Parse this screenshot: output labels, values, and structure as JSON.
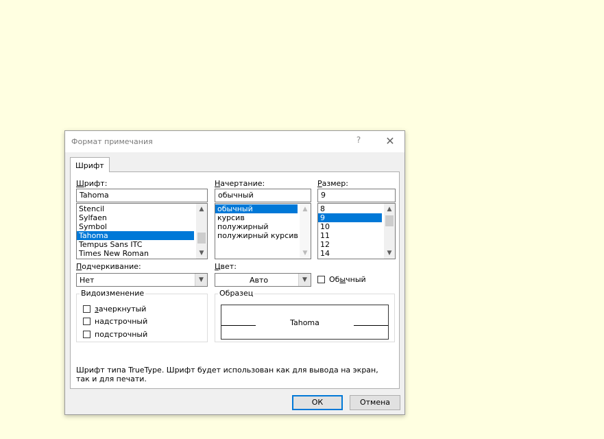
{
  "dialog": {
    "title": "Формат примечания",
    "help_label": "?",
    "close_label": "✕"
  },
  "tabs": [
    {
      "label": "Шрифт",
      "active": true
    }
  ],
  "font": {
    "label_prefix": "Ш",
    "label_rest": "рифт:",
    "value": "Tahoma",
    "items": [
      "Stencil",
      "Sylfaen",
      "Symbol",
      "Tahoma",
      "Tempus Sans ITC",
      "Times New Roman"
    ],
    "selected_index": 3
  },
  "style": {
    "label_prefix": "Н",
    "label_rest": "ачертание:",
    "value": "обычный",
    "items": [
      "обычный",
      "курсив",
      "полужирный",
      "полужирный курсив"
    ],
    "selected_index": 0
  },
  "size": {
    "label_prefix": "Р",
    "label_rest": "азмер:",
    "value": "9",
    "items": [
      "8",
      "9",
      "10",
      "11",
      "12",
      "14"
    ],
    "selected_index": 1
  },
  "underline": {
    "label_prefix": "П",
    "label_rest": "одчеркивание:",
    "value": "Нет"
  },
  "color": {
    "label_prefix": "Ц",
    "label_rest": "вет:",
    "value": "Авто"
  },
  "normal_checkbox": {
    "label_start": "Об",
    "label_underlined": "ы",
    "label_end": "чный",
    "checked": false
  },
  "effects": {
    "title": "Видоизменение",
    "items": [
      {
        "underlined": "з",
        "rest": "ачеркнутый",
        "checked": false
      },
      {
        "underlined": "",
        "rest": "надстрочный",
        "checked": false
      },
      {
        "underlined": "",
        "rest": "подстрочный",
        "checked": false
      }
    ]
  },
  "preview": {
    "title": "Образец",
    "text": "Tahoma"
  },
  "info_text": "Шрифт типа TrueType. Шрифт будет использован как для вывода на экран, так и для печати.",
  "buttons": {
    "ok": "ОК",
    "cancel": "Отмена"
  },
  "colors": {
    "background": "#ffffe1",
    "selection": "#0078d7"
  }
}
